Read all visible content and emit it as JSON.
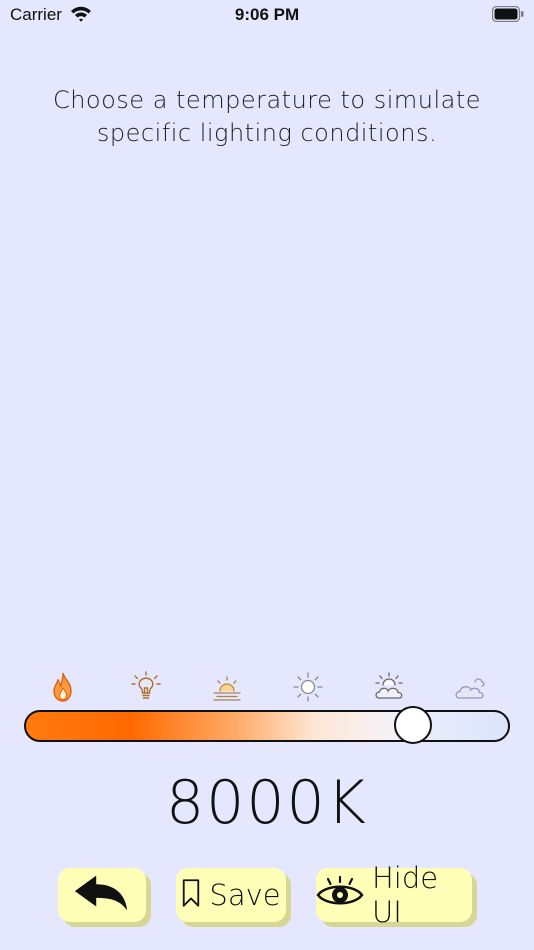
{
  "status_bar": {
    "carrier": "Carrier",
    "time": "9:06 PM",
    "wifi_icon": "wifi-icon",
    "battery_icon": "battery-icon"
  },
  "instruction": {
    "line1": "Choose a temperature to simulate",
    "line2": "specific lighting conditions."
  },
  "conditions": {
    "icons": [
      "flame-icon",
      "lightbulb-icon",
      "sunrise-icon",
      "sun-icon",
      "partly-cloudy-icon",
      "cloud-icon"
    ]
  },
  "slider": {
    "value_fraction": 0.825
  },
  "temperature": {
    "value": "8000K"
  },
  "buttons": {
    "back_icon": "back-arrow-icon",
    "save_label": "Save",
    "save_icon": "bookmark-icon",
    "hide_ui_label": "Hide UI",
    "hide_ui_icon": "eye-icon"
  },
  "colors": {
    "background": "#e4e7fd",
    "button_fill": "#ffffb8",
    "button_shadow": "#d8d694",
    "slider_warm": "#ff6a00",
    "slider_cool": "#dce4fb"
  }
}
